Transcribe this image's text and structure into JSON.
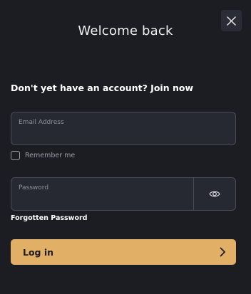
{
  "dialog": {
    "title": "Welcome back",
    "close_icon": "close-icon"
  },
  "signup_prompt": "Don't yet have an account? Join now",
  "email": {
    "label": "Email Address",
    "value": ""
  },
  "remember": {
    "label": "Remember me",
    "checked": false
  },
  "password": {
    "label": "Password",
    "value": "",
    "toggle_icon": "eye-icon"
  },
  "forgot_label": "Forgotten Password",
  "login": {
    "label": "Log in",
    "icon": "chevron-right-icon"
  },
  "colors": {
    "background": "#1c1d23",
    "field_bg": "#262832",
    "border": "#4a4c57",
    "accent": "#e1b066"
  }
}
